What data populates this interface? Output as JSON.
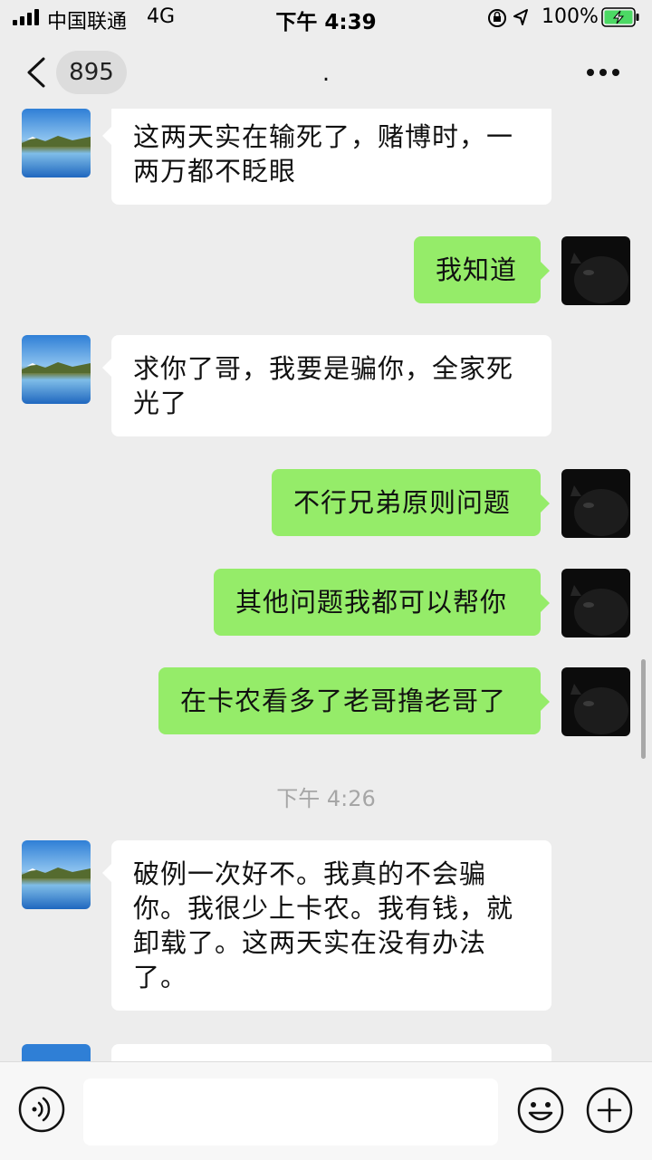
{
  "status_bar": {
    "carrier": "中国联通",
    "network": "4G",
    "time": "下午 4:39",
    "battery_percent": "100%"
  },
  "nav": {
    "unread_badge": "895",
    "title": "."
  },
  "messages": [
    {
      "side": "left",
      "text": "这两天实在输死了，赌博时，一两万都不眨眼"
    },
    {
      "side": "right",
      "text": "我知道"
    },
    {
      "side": "left",
      "text": "求你了哥，我要是骗你，全家死光了"
    },
    {
      "side": "right",
      "text": "不行兄弟原则问题"
    },
    {
      "side": "right",
      "text": "其他问题我都可以帮你"
    },
    {
      "side": "right",
      "text": "在卡农看多了老哥撸老哥了"
    },
    {
      "side": "left",
      "text": "破例一次好不。我真的不会骗你。我很少上卡农。我有钱，就卸载了。这两天实在没有办法了。"
    }
  ],
  "timestamp": "下午 4:26",
  "colors": {
    "background": "#ededed",
    "sent_bubble": "#95ec69",
    "received_bubble": "#ffffff",
    "battery_charging": "#4cd964"
  },
  "icons": [
    "back-chevron-icon",
    "more-icon",
    "voice-icon",
    "emoji-icon",
    "plus-icon",
    "signal-icon",
    "location-arrow-icon",
    "rotation-lock-icon",
    "battery-icon"
  ]
}
